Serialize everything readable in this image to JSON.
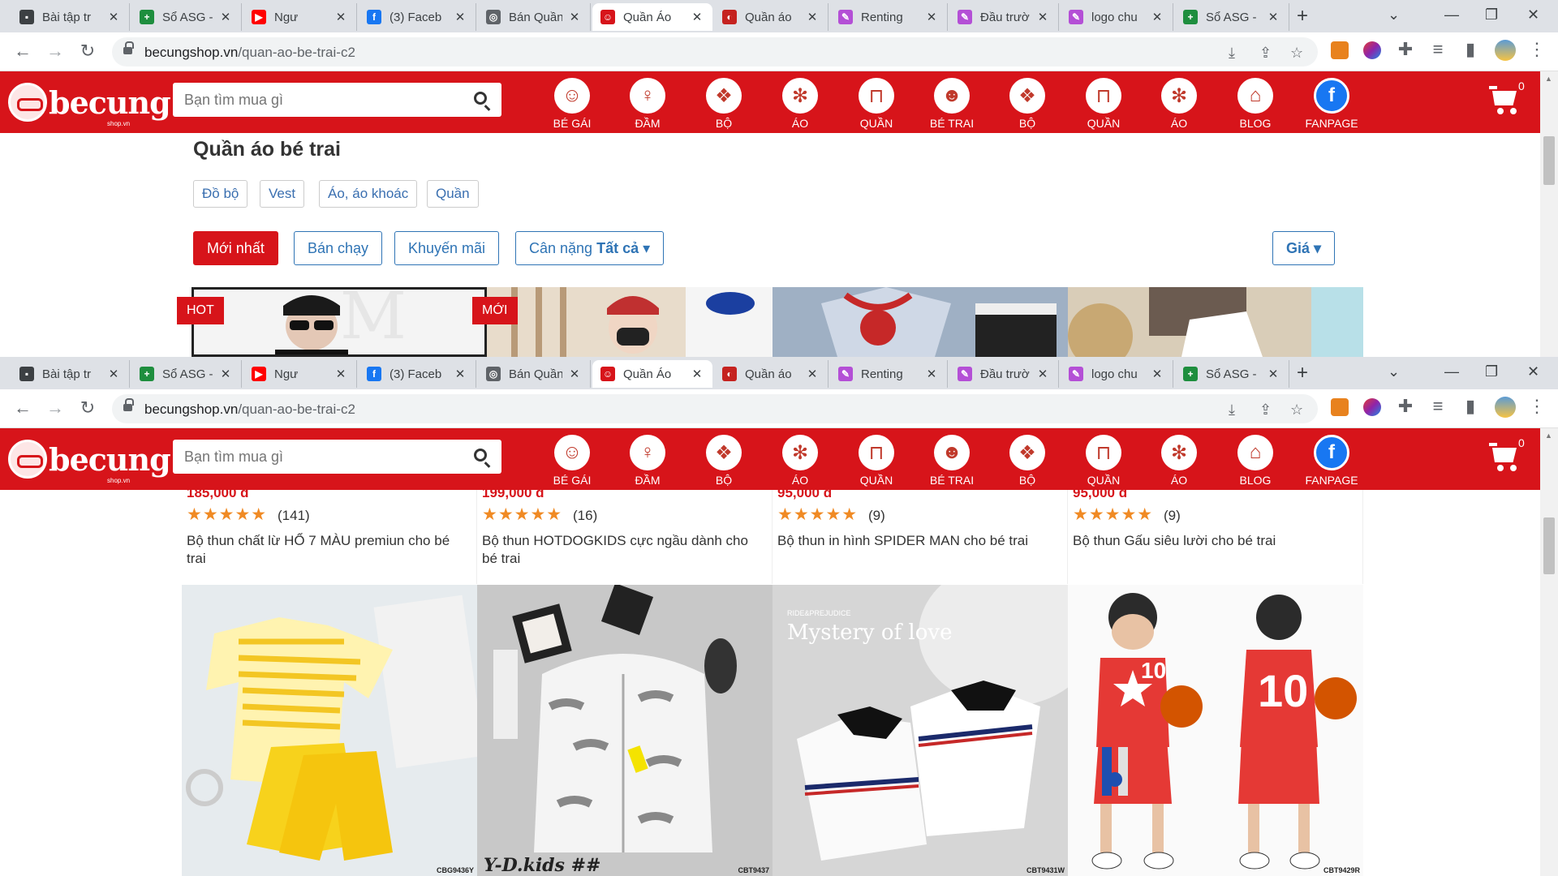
{
  "tabs": [
    {
      "title": "Bài tập tr",
      "color": "#3c4043",
      "glyph": "▪"
    },
    {
      "title": "Sổ ASG -",
      "color": "#1e8e3e",
      "glyph": "+"
    },
    {
      "title": "Ngư",
      "color": "#ff0000",
      "glyph": "▶"
    },
    {
      "title": "(3) Faceb",
      "color": "#1877f2",
      "glyph": "f"
    },
    {
      "title": "Bán Quần",
      "color": "#5f6368",
      "glyph": "◎"
    },
    {
      "title": "Quần Áo",
      "color": "#d7141a",
      "glyph": "☺"
    },
    {
      "title": "Quần áo",
      "color": "#c5221f",
      "glyph": "◐"
    },
    {
      "title": "Renting",
      "color": "#b44fd6",
      "glyph": "✎"
    },
    {
      "title": "Đầu trườ",
      "color": "#b44fd6",
      "glyph": "✎"
    },
    {
      "title": "logo chu",
      "color": "#b44fd6",
      "glyph": "✎"
    },
    {
      "title": "Sổ ASG -",
      "color": "#1e8e3e",
      "glyph": "+"
    }
  ],
  "browser": {
    "domain": "becungshop.vn",
    "path": "/quan-ao-be-trai-c2",
    "new_tab": "+",
    "minimize": "⌄",
    "restore": "—",
    "maximize": "❐",
    "close": "✕"
  },
  "site": {
    "brand": "becung",
    "brand_sub": "shop.vn",
    "search_placeholder": "Bạn tìm mua gì",
    "cart_count": "0",
    "nav": [
      {
        "label": "BÉ GÁI",
        "icon": "☺"
      },
      {
        "label": "ĐẦM",
        "icon": "♀"
      },
      {
        "label": "BỘ",
        "icon": "❖"
      },
      {
        "label": "ÁO",
        "icon": "✻"
      },
      {
        "label": "QUẦN",
        "icon": "⊓"
      },
      {
        "label": "BÉ TRAI",
        "icon": "☻"
      },
      {
        "label": "BỘ",
        "icon": "❖"
      },
      {
        "label": "QUẦN",
        "icon": "⊓"
      },
      {
        "label": "ÁO",
        "icon": "✻"
      },
      {
        "label": "BLOG",
        "icon": "⌂"
      },
      {
        "label": "FANPAGE",
        "icon": "f"
      }
    ]
  },
  "page": {
    "title": "Quần áo bé trai",
    "categories": [
      "Đồ bộ",
      "Vest",
      "Áo, áo khoác",
      "Quần"
    ],
    "sort": {
      "newest": "Mới nhất",
      "best": "Bán chạy",
      "promo": "Khuyến mãi",
      "weight_label": "Cân nặng",
      "weight_value": "Tất cả",
      "price": "Giá"
    },
    "top_tags": [
      "HOT",
      "MỚI"
    ]
  },
  "products": [
    {
      "price": "185,000 đ",
      "stars": "★★★★★",
      "reviews": "(141)",
      "name": "Bộ thun chất lừ HỔ 7 MÀU premiun cho bé trai"
    },
    {
      "price": "199,000 đ",
      "stars": "★★★★★",
      "reviews": "(16)",
      "name": "Bộ thun HOTDOGKIDS cực ngầu dành cho bé trai"
    },
    {
      "price": "95,000 đ",
      "stars": "★★★★★",
      "reviews": "(9)",
      "name": "Bộ thun in hình SPIDER MAN cho bé trai"
    },
    {
      "price": "95,000 đ",
      "stars": "★★★★★",
      "reviews": "(9)",
      "name": "Bộ thun Gấu siêu lười cho bé trai"
    }
  ],
  "product_images": [
    {
      "code": "CBG9436Y",
      "overlay": ""
    },
    {
      "code": "CBT9437",
      "overlay": "Y-D.kids ##"
    },
    {
      "code": "CBT9431W",
      "overlay": "Mystery of love",
      "overlay_sub": "RIDE&PREJUDICE"
    },
    {
      "code": "CBT9429R",
      "overlay": "10"
    }
  ]
}
